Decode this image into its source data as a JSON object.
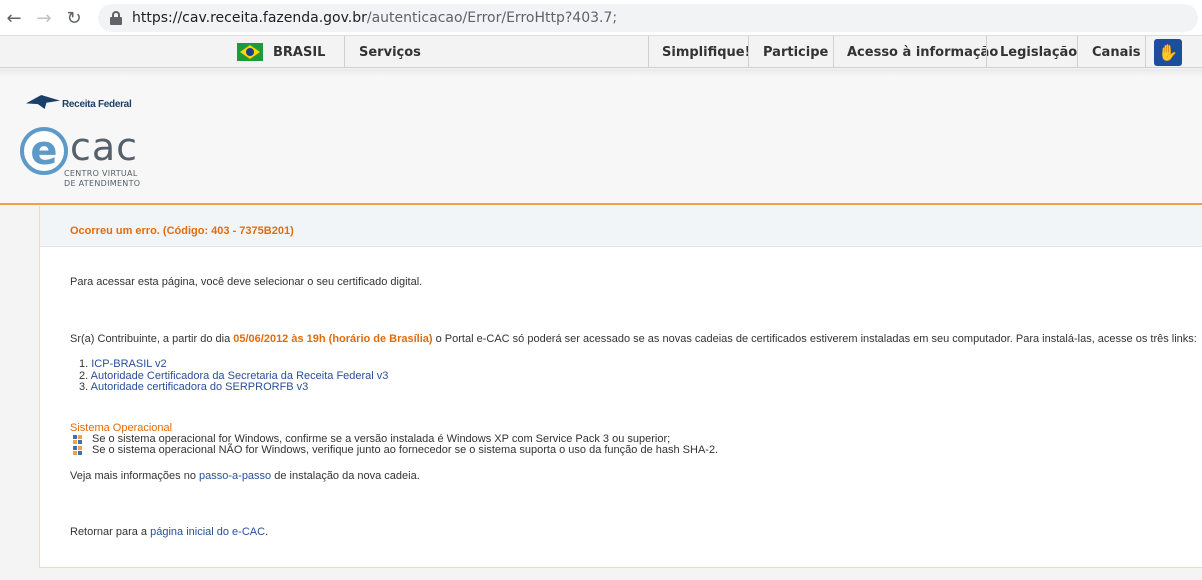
{
  "browser": {
    "url_host": "https://cav.receita.fazenda.gov.br",
    "url_path": "/autenticacao/Error/ErroHttp?403.7;"
  },
  "govbar": {
    "brasil": "BRASIL",
    "servicos": "Serviços",
    "simplifique": "Simplifique!",
    "participe": "Participe",
    "acesso": "Acesso à informação",
    "legislacao": "Legislação",
    "canais": "Canais"
  },
  "header": {
    "rf_logo_text": "Receita Federal",
    "ecac_e": "e",
    "ecac_cac": "cac",
    "ecac_sub1": "CENTRO VIRTUAL",
    "ecac_sub2": "DE ATENDIMENTO"
  },
  "error": {
    "title": "Ocorreu um erro. (Código: 403 - 7375B201)"
  },
  "body": {
    "p1": "Para acessar esta página, você deve selecionar o seu certificado digital.",
    "p2_a": "Sr(a) Contribuinte, a partir do dia ",
    "p2_date": "05/06/2012 às 19h (horário de Brasília)",
    "p2_b": " o Portal e-CAC só poderá ser acessado se as novas cadeias de certificados estiverem instaladas em seu computador. Para instalá-las, acesse os três links:",
    "links": [
      {
        "num": "1.",
        "label": "ICP-BRASIL v2"
      },
      {
        "num": "2.",
        "label": "Autoridade Certificadora da Secretaria da Receita Federal v3"
      },
      {
        "num": "3.",
        "label": "Autoridade certificadora do SERPRORFB v3"
      }
    ],
    "so_title": "Sistema Operacional",
    "so_items": [
      "Se o sistema operacional for Windows, confirme se a versão instalada é Windows XP com Service Pack 3 ou superior;",
      "Se o sistema operacional NÃO for Windows, verifique junto ao fornecedor se o sistema suporta o uso da função de hash SHA-2."
    ],
    "more_a": "Veja mais informações no ",
    "more_link": "passo-a-passo",
    "more_b": " de instalação da nova cadeia.",
    "return_a": "Retornar para a ",
    "return_link": "página inicial do e-CAC",
    "return_b": "."
  },
  "colors": {
    "accent_orange": "#e36c0a",
    "link_blue": "#2a4f9a",
    "ecac_blue": "#5e9ac8"
  }
}
